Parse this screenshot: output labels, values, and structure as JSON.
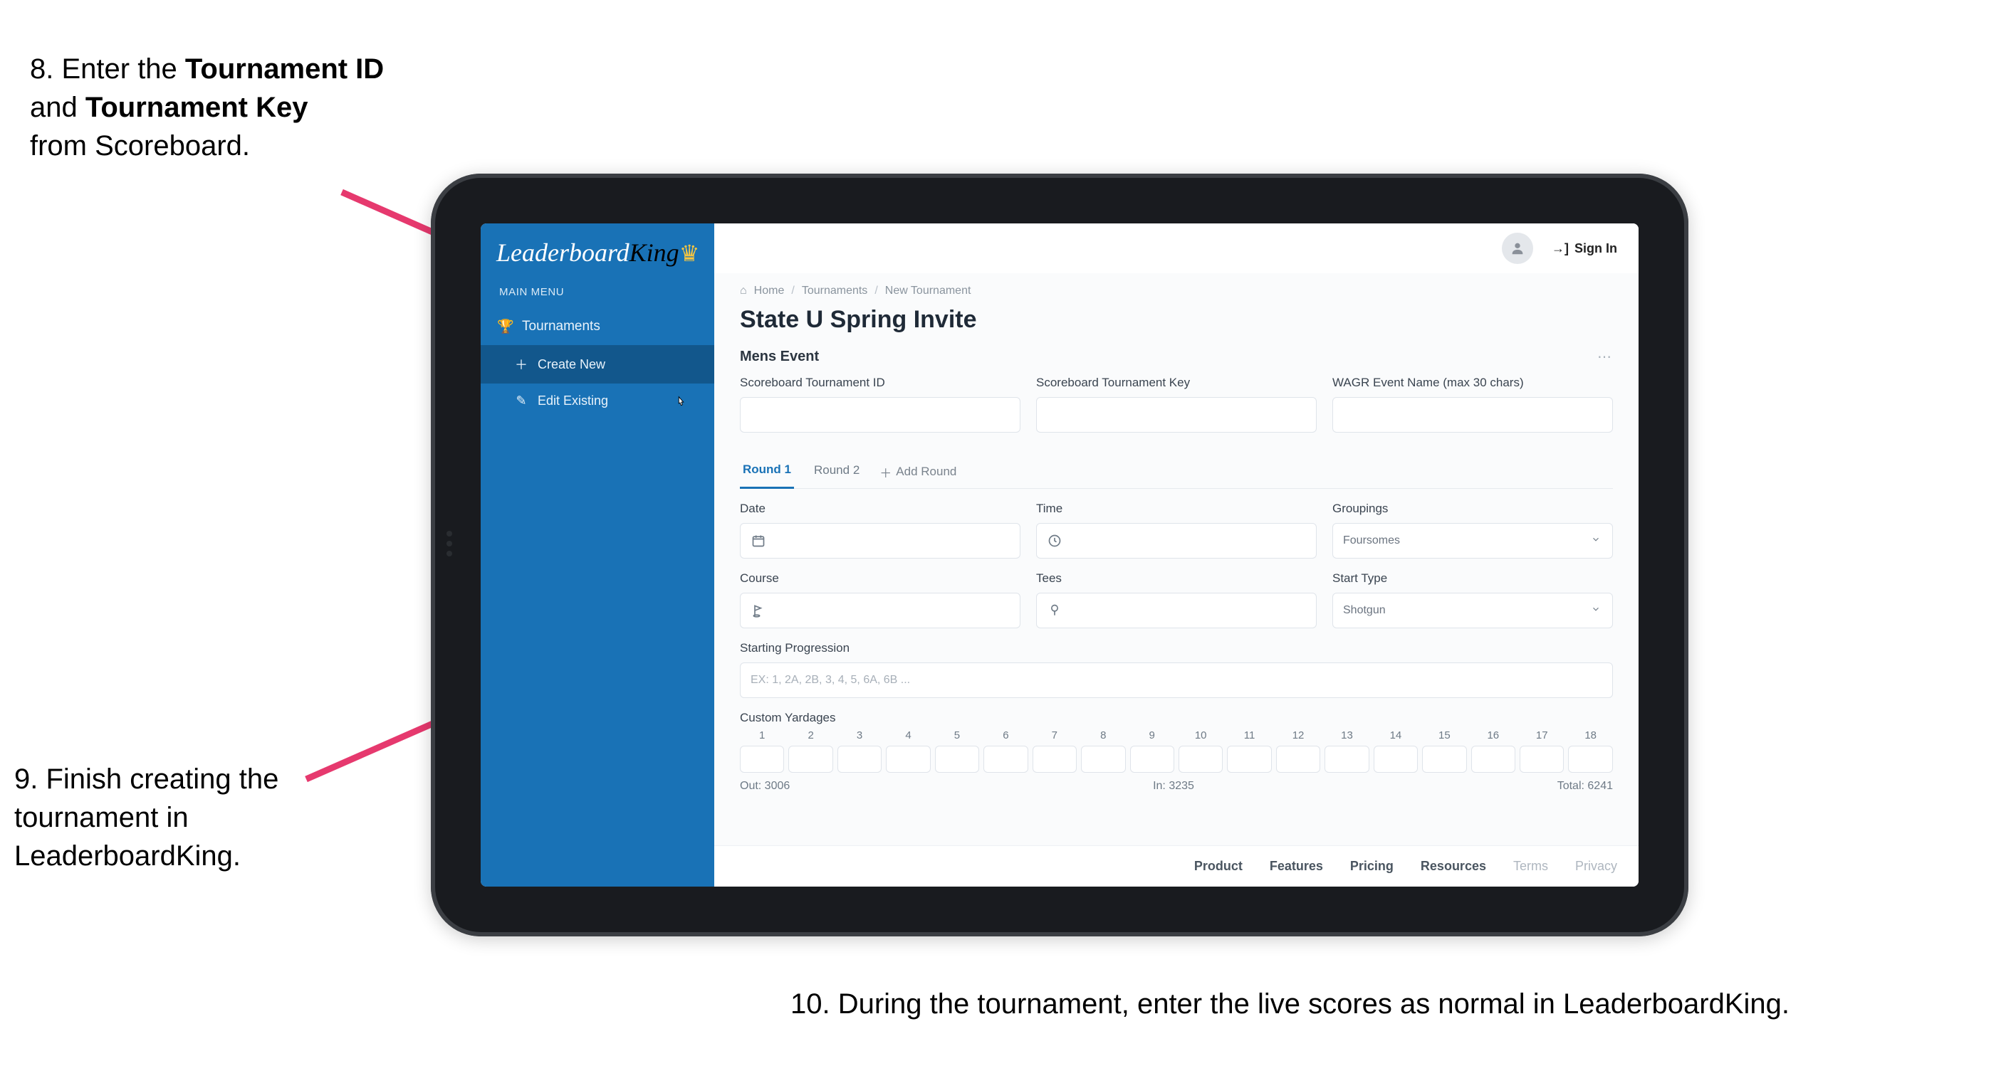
{
  "callouts": {
    "step8": {
      "prefix": "8. Enter the ",
      "b1": "Tournament ID",
      "mid": "and ",
      "b2": "Tournament Key",
      "suffix": "from Scoreboard."
    },
    "step9": "9. Finish creating the tournament in LeaderboardKing.",
    "step10": "10. During the tournament, enter the live scores as normal in LeaderboardKing."
  },
  "logo": {
    "part1": "Leaderboard",
    "part2": "King"
  },
  "sidebar": {
    "mainMenu": "MAIN MENU",
    "tournaments": "Tournaments",
    "createNew": "Create New",
    "editExisting": "Edit Existing"
  },
  "topbar": {
    "signIn": "Sign In"
  },
  "breadcrumb": {
    "home": "Home",
    "tournaments": "Tournaments",
    "newTournament": "New Tournament"
  },
  "page": {
    "title": "State U Spring Invite"
  },
  "section": {
    "title": "Mens Event",
    "fields": {
      "sbId": "Scoreboard Tournament ID",
      "sbKey": "Scoreboard Tournament Key",
      "wagr": "WAGR Event Name (max 30 chars)"
    }
  },
  "tabs": {
    "r1": "Round 1",
    "r2": "Round 2",
    "add": "Add Round"
  },
  "round": {
    "date": "Date",
    "time": "Time",
    "groupings": {
      "label": "Groupings",
      "value": "Foursomes"
    },
    "course": "Course",
    "tees": "Tees",
    "startType": {
      "label": "Start Type",
      "value": "Shotgun"
    },
    "startingProgression": {
      "label": "Starting Progression",
      "placeholder": "EX: 1, 2A, 2B, 3, 4, 5, 6A, 6B ..."
    },
    "customYardages": "Custom Yardages",
    "holes": [
      "1",
      "2",
      "3",
      "4",
      "5",
      "6",
      "7",
      "8",
      "9",
      "10",
      "11",
      "12",
      "13",
      "14",
      "15",
      "16",
      "17",
      "18"
    ],
    "totals": {
      "out": "Out: 3006",
      "in": "In: 3235",
      "total": "Total: 6241"
    }
  },
  "footer": {
    "product": "Product",
    "features": "Features",
    "pricing": "Pricing",
    "resources": "Resources",
    "terms": "Terms",
    "privacy": "Privacy"
  },
  "colors": {
    "accent": "#e6396e",
    "sidebar": "#1972b6"
  }
}
